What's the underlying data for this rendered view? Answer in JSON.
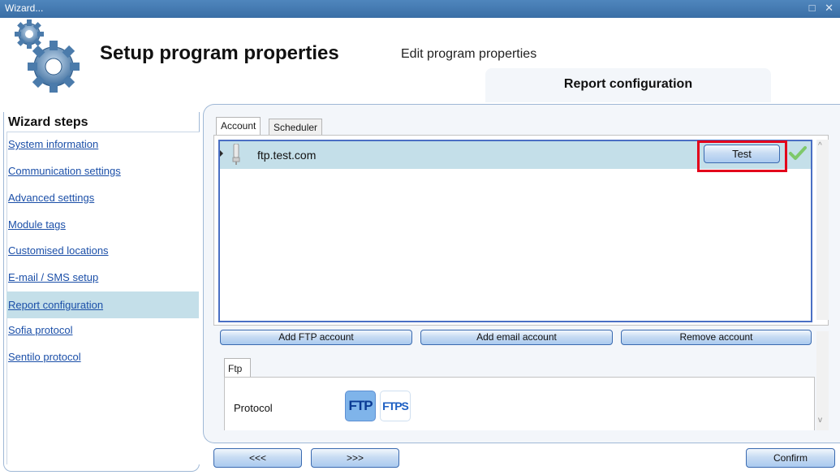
{
  "window": {
    "title": "Wizard...",
    "controls": "□ ✕"
  },
  "header": {
    "title": "Setup program properties",
    "subtitle": "Edit program properties",
    "active_section": "Report configuration"
  },
  "sidebar": {
    "title": "Wizard steps",
    "items": [
      {
        "label": "System information"
      },
      {
        "label": "Communication settings"
      },
      {
        "label": "Advanced settings"
      },
      {
        "label": "Module tags"
      },
      {
        "label": "Customised locations"
      },
      {
        "label": "E-mail / SMS setup"
      },
      {
        "label": "Report configuration",
        "active": true
      },
      {
        "label": "Sofia protocol"
      },
      {
        "label": "Sentilo protocol"
      }
    ]
  },
  "tabs": [
    {
      "label": "Account",
      "active": true
    },
    {
      "label": "Scheduler",
      "active": false
    }
  ],
  "accounts": [
    {
      "name": "ftp.test.com",
      "test_label": "Test",
      "status": "ok"
    }
  ],
  "account_actions": {
    "add_ftp": "Add FTP account",
    "add_email": "Add email account",
    "remove": "Remove account"
  },
  "detail": {
    "tab": "Ftp",
    "protocol_label": "Protocol",
    "protocols": [
      {
        "label": "FTP",
        "selected": true
      },
      {
        "label": "FTPS",
        "selected": false
      }
    ]
  },
  "navigation": {
    "back": "<<<",
    "next": ">>>",
    "confirm": "Confirm"
  },
  "colors": {
    "accent": "#3a6ea5",
    "highlight": "#e3001b",
    "selected_row": "#c4dfe9",
    "link": "#1b4fa8"
  }
}
